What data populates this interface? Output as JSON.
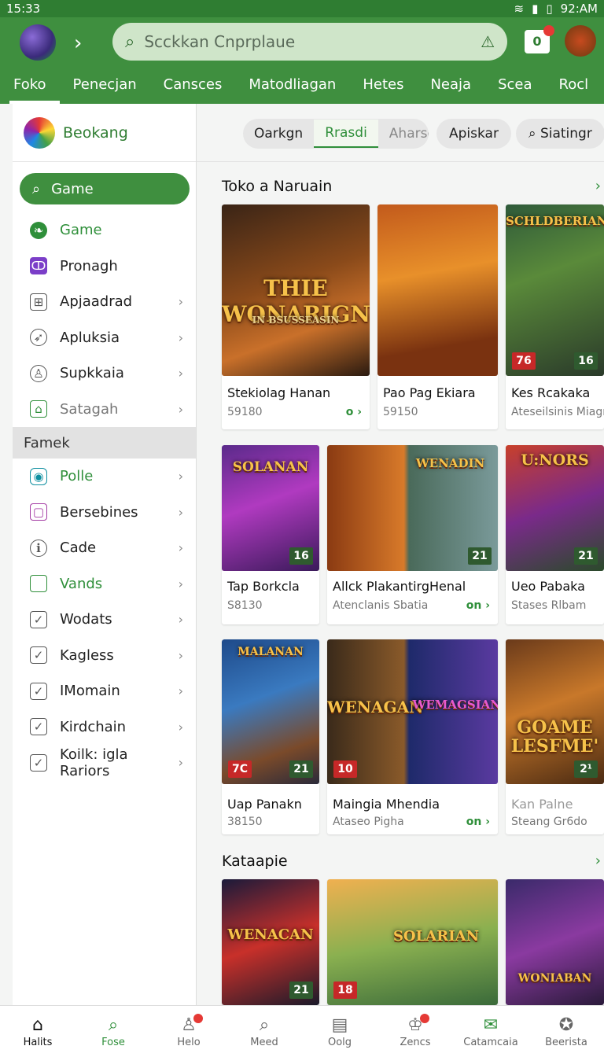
{
  "status": {
    "time_left": "15:33",
    "time_right": "92:AM"
  },
  "header": {
    "search_placeholder": "Scckkan Cnprplaue",
    "notif_count": "0",
    "tabs": [
      "Foko",
      "Penecjan",
      "Cansces",
      "Matodliagan",
      "Hetes",
      "Neaja",
      "Scea",
      "Rocl"
    ]
  },
  "sidebar": {
    "brand": "Beokang",
    "search_label": "Game",
    "items": [
      {
        "label": "Game"
      },
      {
        "label": "Pronagh"
      },
      {
        "label": "Apjaadrad"
      },
      {
        "label": "Apluksia"
      },
      {
        "label": "Supkkaia"
      },
      {
        "label": "Satagah"
      }
    ],
    "section": "Famek",
    "items2": [
      {
        "label": "Polle"
      },
      {
        "label": "Bersebines"
      },
      {
        "label": "Cade"
      },
      {
        "label": "Vands"
      },
      {
        "label": "Wodats"
      },
      {
        "label": "Kagless"
      },
      {
        "label": "IMomain"
      },
      {
        "label": "Kirdchain"
      },
      {
        "label": "Koilk: igla Rariors"
      }
    ]
  },
  "chips": {
    "group": [
      "Oarkgn",
      "Rrasdi",
      "Aharses"
    ],
    "c1": "Apiskar",
    "c2": "Siatingr"
  },
  "sections": [
    {
      "title": "Toko a Naruain"
    },
    {
      "title": "Kataapie"
    }
  ],
  "cards": {
    "r1": [
      {
        "title": "Stekiolag Hanan",
        "sub": "59180",
        "more": "o ›",
        "art": "THIE WONARIGN",
        "art2": "IN BSUSSEASIN"
      },
      {
        "title": "Pao Pag Ekiara",
        "sub": "59150"
      },
      {
        "title": "Kes Rcakaka",
        "sub": "Ateseilsinis Miagn",
        "art": "SCHLDBERIAN",
        "b1": "76",
        "b2": "16"
      }
    ],
    "r2": [
      {
        "title": "Tap Borkcla",
        "sub": "S8130",
        "art": "SOLANAN",
        "b2": "16"
      },
      {
        "title": "Allck PlakantirgHenal",
        "sub": "Atenclanis Sbatia",
        "more": "on ›",
        "art": "WENADIN",
        "b2": "21"
      },
      {
        "title": "Ueo Pabaka",
        "sub": "Stases Rlbam",
        "art": "U:NORS",
        "b2": "21"
      }
    ],
    "r3": [
      {
        "title": "Uap Panakn",
        "sub": "38150",
        "art": "MALANAN",
        "b1": "7C",
        "b2": "21"
      },
      {
        "title": "Maingia Mhendia",
        "sub": "Ataseo Pigha",
        "more": "on ›",
        "art": "WENAGAN",
        "art_b": "WEMAGSIAN",
        "b1": "10"
      },
      {
        "title": "Kan Palne",
        "sub": "Steang Gr6do",
        "art": "GOAME LESFME'",
        "b2": "2¹"
      }
    ],
    "r4": [
      {
        "art": "WENACAN",
        "b2": "21"
      },
      {
        "art": "SOLARIAN",
        "b1": "18"
      },
      {
        "art": "WONIABAN"
      }
    ]
  },
  "bottom_nav": [
    "Halits",
    "Fose",
    "Helo",
    "Meed",
    "Oolg",
    "Zencs",
    "Catamcaia",
    "Beerista"
  ]
}
